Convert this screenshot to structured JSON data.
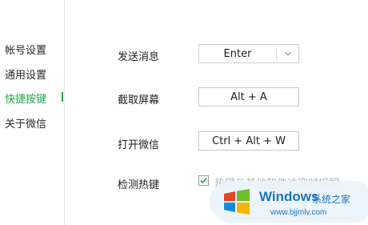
{
  "sidebar": {
    "items": [
      {
        "label": "帐号设置"
      },
      {
        "label": "通用设置"
      },
      {
        "label": "快捷按键"
      },
      {
        "label": "关于微信"
      }
    ],
    "active_index": 2
  },
  "settings": {
    "send_message": {
      "label": "发送消息",
      "value": "Enter"
    },
    "screenshot": {
      "label": "截取屏幕",
      "value": "Alt + A"
    },
    "open_wechat": {
      "label": "打开微信",
      "value": "Ctrl + Alt + W"
    },
    "detect_hotkeys": {
      "label": "检测热键",
      "checked": true,
      "checkbox_text": "热键与其他软件冲突时提醒"
    }
  },
  "watermark": {
    "brand": "Windows",
    "subtitle": "系统之家",
    "url": "www.bjjmlv.com"
  },
  "colors": {
    "accent": "#20a84b",
    "watermark_blue": "#1a73c5"
  }
}
